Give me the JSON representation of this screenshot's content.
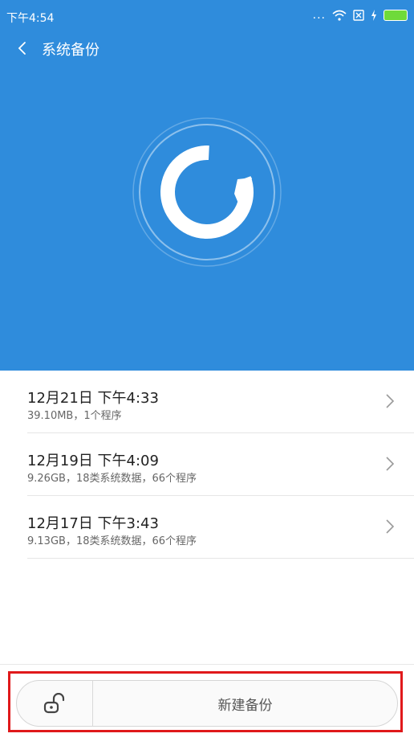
{
  "status_bar": {
    "time": "下午4:54",
    "dots": "..."
  },
  "header": {
    "title": "系统备份"
  },
  "backups": [
    {
      "title": "12月21日 下午4:33",
      "subtitle": "39.10MB，1个程序"
    },
    {
      "title": "12月19日 下午4:09",
      "subtitle": "9.26GB，18类系统数据，66个程序"
    },
    {
      "title": "12月17日 下午3:43",
      "subtitle": "9.13GB，18类系统数据，66个程序"
    }
  ],
  "bottom": {
    "new_backup_label": "新建备份",
    "lock_icon": "unlock-icon"
  },
  "colors": {
    "accent": "#2f8cdc",
    "highlight": "#e0191b"
  }
}
